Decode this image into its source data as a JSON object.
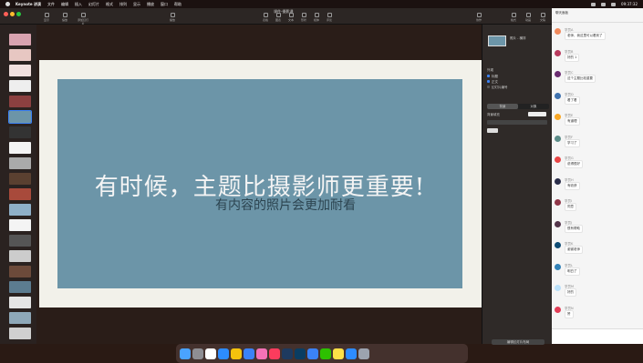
{
  "menubar": {
    "app_name": "Keynote 讲演",
    "items": [
      "文件",
      "编辑",
      "插入",
      "幻灯片",
      "格式",
      "排列",
      "显示",
      "播放",
      "窗口",
      "帮助"
    ],
    "clock": "09:37:32"
  },
  "keynote": {
    "doc_title": "课件-摄影课",
    "toolbar": [
      "显示",
      "缩放",
      "添加幻灯片",
      "播放",
      "表格",
      "图表",
      "文本",
      "形状",
      "媒体",
      "评论",
      "协作",
      "格式",
      "动画",
      "文稿"
    ],
    "slide": {
      "title": "有时候，主题比摄影师更重要!",
      "subtitle": "有内容的照片会更加耐看"
    },
    "inspector": {
      "layout_name": "照片 - 横排",
      "section_label": "外观",
      "checks": [
        "标题",
        "正文",
        "幻灯片编号"
      ],
      "tabs": [
        "背景",
        "对象"
      ],
      "bg_label": "背景填充",
      "footer_btn": "编辑幻灯片布局"
    }
  },
  "chat": {
    "header": "聊天面板",
    "messages": [
      {
        "name": "学员A",
        "text": "老师，我这里可以看到了",
        "color": "#f08a5d"
      },
      {
        "name": "学员B",
        "text": "好的 1",
        "color": "#b83b5e"
      },
      {
        "name": "学员C",
        "text": "这个主题比较重要",
        "color": "#6a2c70"
      },
      {
        "name": "学员D",
        "text": "看了看",
        "color": "#3f72af"
      },
      {
        "name": "学员E",
        "text": "有道理",
        "color": "#f9a826"
      },
      {
        "name": "学员F",
        "text": "学习了",
        "color": "#5c8d89"
      },
      {
        "name": "学员G",
        "text": "说得很好",
        "color": "#e84545"
      },
      {
        "name": "学员H",
        "text": "有收获",
        "color": "#2b2e4a"
      },
      {
        "name": "学员I",
        "text": "同意",
        "color": "#903749"
      },
      {
        "name": "学员J",
        "text": "很有帮助",
        "color": "#53354a"
      },
      {
        "name": "学员K",
        "text": "谢谢老师",
        "color": "#0f4c75"
      },
      {
        "name": "学员L",
        "text": "明白了",
        "color": "#3282b8"
      },
      {
        "name": "学员M",
        "text": "好的",
        "color": "#bbe1fa"
      },
      {
        "name": "学员N",
        "text": "赞",
        "color": "#e23e57"
      }
    ]
  },
  "dock": {
    "icons": [
      "finder",
      "launchpad",
      "calendar",
      "safari",
      "chrome",
      "mail",
      "photos",
      "music",
      "lightroom",
      "photoshop",
      "keynote",
      "wechat",
      "notes",
      "zoom",
      "trash"
    ]
  },
  "colors": {
    "slide_photo": "#6c95a8",
    "accent": "#3b82f6"
  }
}
